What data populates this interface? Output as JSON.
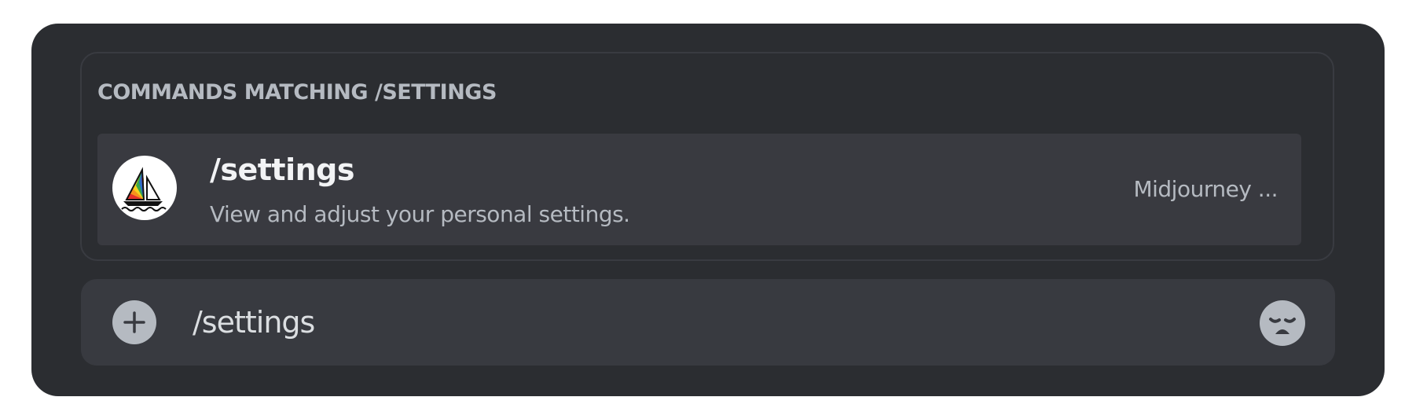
{
  "popup": {
    "heading": "COMMANDS MATCHING /SETTINGS",
    "commands": [
      {
        "name": "/settings",
        "description": "View and adjust your personal settings.",
        "source": "Midjourney ...",
        "icon": "midjourney-sailboat-icon"
      }
    ]
  },
  "composer": {
    "value": "/settings",
    "add_icon": "plus-circle-icon",
    "emoji_icon": "sad-face-emoji-icon"
  },
  "colors": {
    "frame_bg": "#2b2d31",
    "row_bg": "#393a40",
    "input_bg": "#383a40",
    "muted_text": "#b5bac1",
    "bright_text": "#f2f3f5"
  }
}
